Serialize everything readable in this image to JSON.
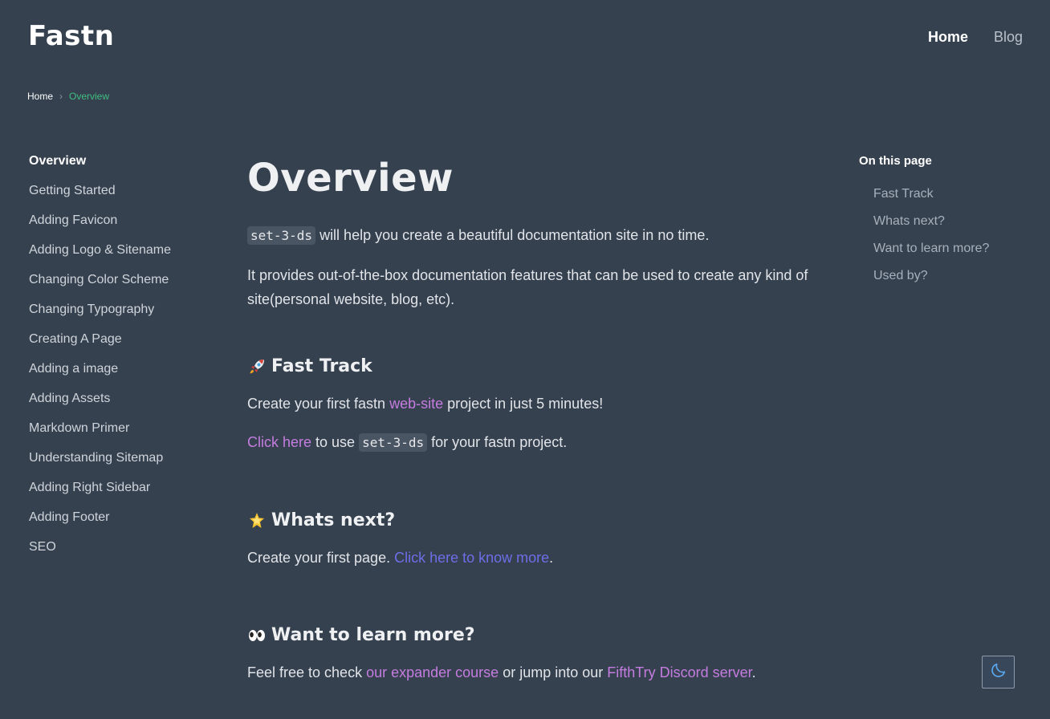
{
  "header": {
    "logo": "Fastn",
    "nav": [
      {
        "label": "Home",
        "active": true
      },
      {
        "label": "Blog",
        "active": false
      }
    ]
  },
  "breadcrumb": {
    "items": [
      "Home",
      "Overview"
    ],
    "separator": "›"
  },
  "sidebar": {
    "items": [
      {
        "label": "Overview",
        "active": true
      },
      {
        "label": "Getting Started"
      },
      {
        "label": "Adding Favicon"
      },
      {
        "label": "Adding Logo & Sitename"
      },
      {
        "label": "Changing Color Scheme"
      },
      {
        "label": "Changing Typography"
      },
      {
        "label": "Creating A Page"
      },
      {
        "label": "Adding a image"
      },
      {
        "label": "Adding Assets"
      },
      {
        "label": "Markdown Primer"
      },
      {
        "label": "Understanding Sitemap"
      },
      {
        "label": "Adding Right Sidebar"
      },
      {
        "label": "Adding Footer"
      },
      {
        "label": "SEO"
      }
    ]
  },
  "main": {
    "title": "Overview",
    "intro": {
      "code": "set-3-ds",
      "text": " will help you create a beautiful documentation site in no time."
    },
    "intro2": "It provides out-of-the-box documentation features that can be used to create any kind of site(personal website, blog, etc).",
    "fast_track": {
      "heading": "Fast Track",
      "p1_before": "Create your first fastn ",
      "p1_link": "web-site",
      "p1_after": " project in just 5 minutes!",
      "p2_link": "Click here",
      "p2_mid": " to use ",
      "p2_code": "set-3-ds",
      "p2_after": " for your fastn project."
    },
    "whats_next": {
      "heading": "Whats next?",
      "p_before": "Create your first page. ",
      "p_link": "Click here to know more",
      "p_after": "."
    },
    "learn_more": {
      "heading": "Want to learn more?",
      "p_before": "Feel free to check ",
      "p_link1": "our expander course",
      "p_mid": " or jump into our ",
      "p_link2": "FifthTry Discord server",
      "p_after": "."
    }
  },
  "toc": {
    "title": "On this page",
    "items": [
      "Fast Track",
      "Whats next?",
      "Want to learn more?",
      "Used by?"
    ]
  },
  "theme_toggle": {
    "icon": "moon-icon"
  },
  "colors": {
    "background": "#364150",
    "accent_green": "#3fbf7f",
    "link_purple": "#c57cdf",
    "link_blue": "#6d6ee6"
  }
}
